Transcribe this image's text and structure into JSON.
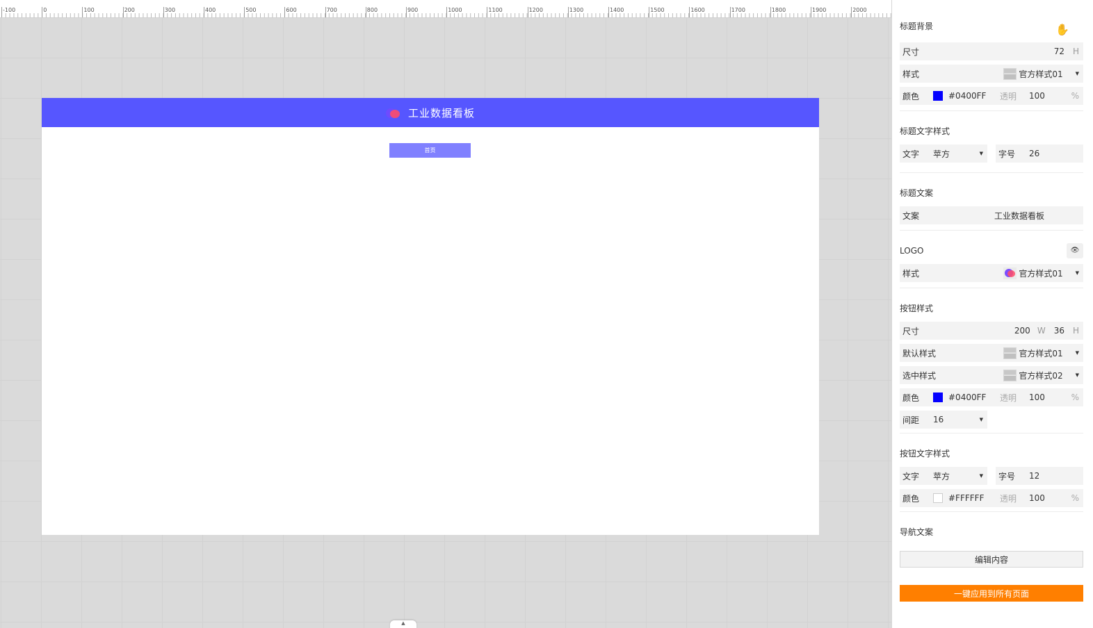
{
  "ruler": {
    "labels": [
      "-100",
      "0",
      "100",
      "200",
      "300",
      "400",
      "500",
      "600",
      "700",
      "800",
      "900",
      "1000",
      "1100",
      "1200",
      "1300",
      "1400",
      "1500",
      "1600",
      "1700",
      "1800",
      "1900",
      "2000"
    ]
  },
  "artboard": {
    "header_title": "工业数据看板",
    "nav_button_label": "首页",
    "header_color": "#5656ff"
  },
  "panel": {
    "title_bg": {
      "section": "标题背景",
      "size_label": "尺寸",
      "size_value": "72",
      "size_unit": "H",
      "style_label": "样式",
      "style_value": "官方样式01",
      "color_label": "颜色",
      "color_value": "#0400FF",
      "opacity_label": "透明",
      "opacity_value": "100",
      "opacity_unit": "%"
    },
    "title_text_style": {
      "section": "标题文字样式",
      "font_label": "文字",
      "font_value": "苹方",
      "size_label": "字号",
      "size_value": "26"
    },
    "title_copy": {
      "section": "标题文案",
      "copy_label": "文案",
      "copy_value": "工业数据看板"
    },
    "logo": {
      "section": "LOGO",
      "style_label": "样式",
      "style_value": "官方样式01"
    },
    "button_style": {
      "section": "按钮样式",
      "size_label": "尺寸",
      "width_value": "200",
      "width_unit": "W",
      "height_value": "36",
      "height_unit": "H",
      "default_label": "默认样式",
      "default_value": "官方样式01",
      "selected_label": "选中样式",
      "selected_value": "官方样式02",
      "color_label": "颜色",
      "color_value": "#0400FF",
      "opacity_label": "透明",
      "opacity_value": "100",
      "opacity_unit": "%",
      "spacing_label": "间距",
      "spacing_value": "16"
    },
    "button_text_style": {
      "section": "按钮文字样式",
      "font_label": "文字",
      "font_value": "苹方",
      "size_label": "字号",
      "size_value": "12",
      "color_label": "颜色",
      "color_value": "#FFFFFF",
      "opacity_label": "透明",
      "opacity_value": "100",
      "opacity_unit": "%"
    },
    "nav_copy": {
      "section": "导航文案",
      "edit_button": "编辑内容"
    },
    "apply_all_button": "一键应用到所有页面",
    "accent_color": "#ff7f00",
    "swatch_blue": "#0400ff",
    "swatch_white": "#ffffff"
  },
  "icons": {
    "hand": "hand-icon",
    "eye": "eye-icon",
    "caret": "caret-down-icon",
    "collapse": "chevron-up-icon"
  }
}
